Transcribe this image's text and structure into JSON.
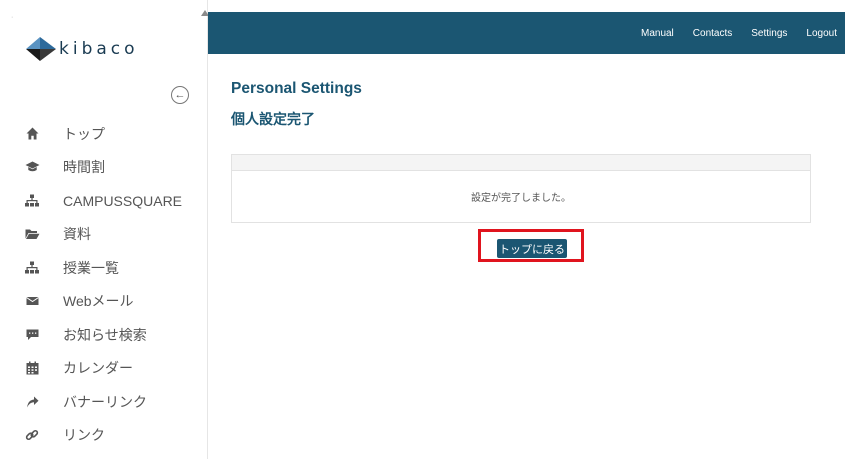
{
  "logo": {
    "text": "kibaco"
  },
  "sidebar": {
    "items": [
      {
        "label": "トップ",
        "icon": "home-icon"
      },
      {
        "label": "時間割",
        "icon": "graduation-cap-icon"
      },
      {
        "label": "CAMPUSSQUARE",
        "icon": "sitemap-icon"
      },
      {
        "label": "資料",
        "icon": "folder-open-icon"
      },
      {
        "label": "授業一覧",
        "icon": "sitemap-icon"
      },
      {
        "label": "Webメール",
        "icon": "envelope-icon"
      },
      {
        "label": "お知らせ検索",
        "icon": "comment-icon"
      },
      {
        "label": "カレンダー",
        "icon": "calendar-icon"
      },
      {
        "label": "バナーリンク",
        "icon": "arrow-icon"
      },
      {
        "label": "リンク",
        "icon": "link-icon"
      }
    ]
  },
  "header": {
    "links": [
      "Manual",
      "Contacts",
      "Settings",
      "Logout"
    ]
  },
  "main": {
    "title": "Personal Settings",
    "subtitle": "個人設定完了",
    "message": "設定が完了しました。",
    "back_button": "トップに戻る"
  },
  "colors": {
    "brand": "#1b5672",
    "highlight": "#e0141e"
  }
}
